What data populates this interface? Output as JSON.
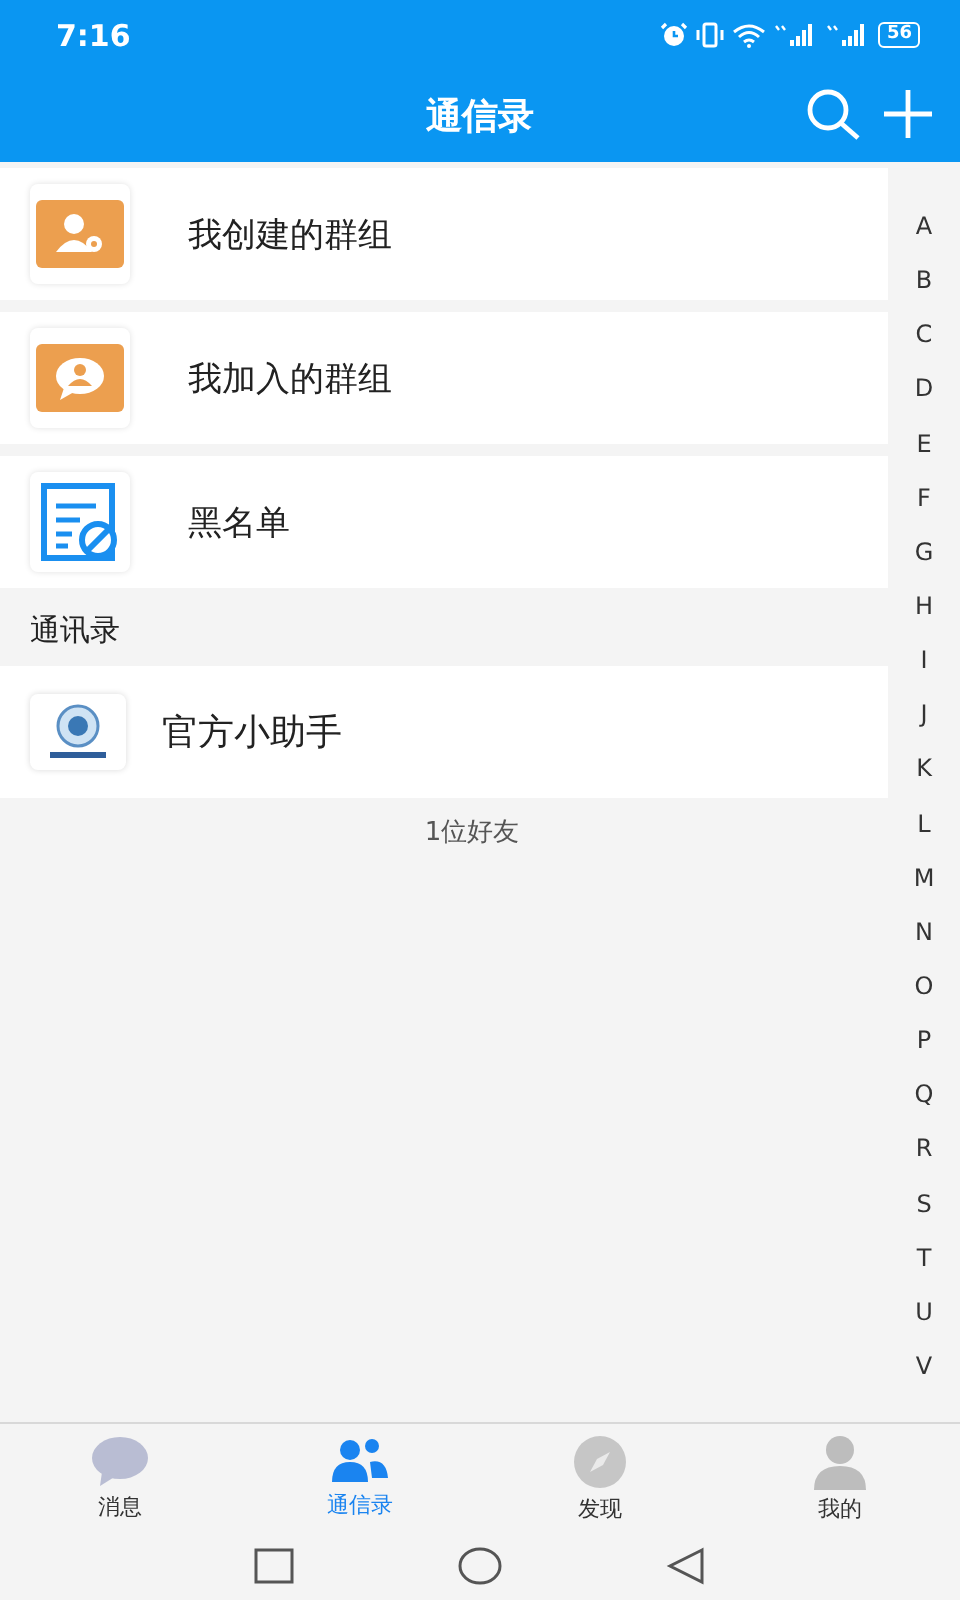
{
  "status_bar": {
    "time": "7:16",
    "battery": "56"
  },
  "header": {
    "title": "通信录"
  },
  "entries": [
    {
      "kind": "created",
      "label": "我创建的群组"
    },
    {
      "kind": "joined",
      "label": "我加入的群组"
    },
    {
      "kind": "blacklist",
      "label": "黑名单"
    }
  ],
  "section": {
    "title": "通讯录"
  },
  "contacts": [
    {
      "name": "官方小助手"
    }
  ],
  "friend_count": "1位好友",
  "index": [
    "A",
    "B",
    "C",
    "D",
    "E",
    "F",
    "G",
    "H",
    "I",
    "J",
    "K",
    "L",
    "M",
    "N",
    "O",
    "P",
    "Q",
    "R",
    "S",
    "T",
    "U",
    "V"
  ],
  "tabs": [
    {
      "kind": "messages",
      "label": "消息",
      "selected": false
    },
    {
      "kind": "contacts",
      "label": "通信录",
      "selected": true
    },
    {
      "kind": "discover",
      "label": "发现",
      "selected": false
    },
    {
      "kind": "me",
      "label": "我的",
      "selected": false
    }
  ]
}
